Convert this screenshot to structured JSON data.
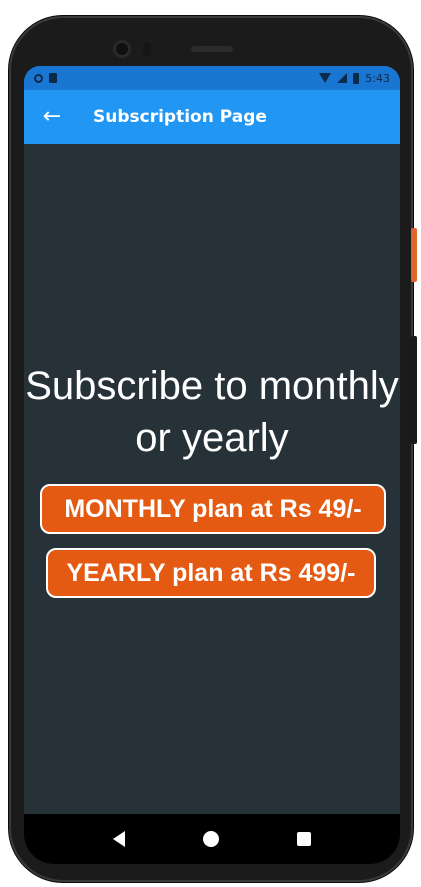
{
  "status_bar": {
    "time": "5:43",
    "icons": [
      "circle-icon",
      "sim-icon",
      "wifi-icon",
      "signal-icon",
      "battery-icon"
    ]
  },
  "app_bar": {
    "title": "Subscription Page",
    "back_icon": "arrow-left-icon"
  },
  "main": {
    "headline": "Subscribe to monthly or yearly",
    "monthly_label": "MONTHLY plan at Rs 49/-",
    "yearly_label": "YEARLY plan at Rs 499/-"
  },
  "nav": {
    "back_icon": "back-triangle-icon",
    "home_icon": "home-circle-icon",
    "recents_icon": "recents-square-icon"
  },
  "colors": {
    "app_bar": "#2196f3",
    "status_bar": "#1976d2",
    "background": "#263238",
    "button": "#e55a12"
  }
}
